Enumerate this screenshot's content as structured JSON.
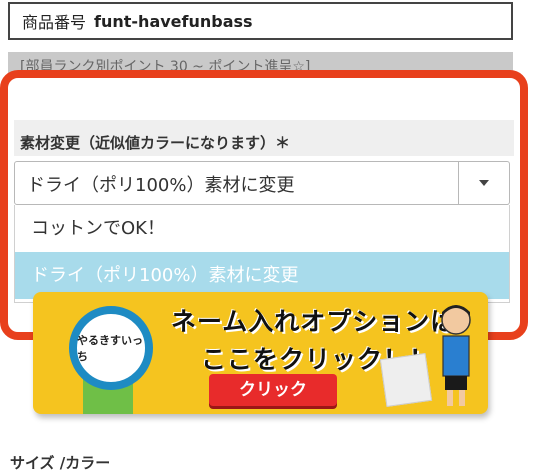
{
  "product": {
    "label": "商品番号",
    "code": "funt-havefunbass"
  },
  "points_banner": {
    "text": "[部員ランク別ポイント 30 ~ ポイント進呈☆]"
  },
  "option": {
    "label": "素材変更（近似値カラーになります）＊",
    "selected_value": "ドライ（ポリ100%）素材に変更",
    "options": [
      "コットンでOK！",
      "ドライ（ポリ100%）素材に変更"
    ]
  },
  "name_banner": {
    "title_line1": "ネーム入れオプションは",
    "title_line2": "ここをクリック！！",
    "button_label": "クリック",
    "badge_text": "やるきすいっち"
  },
  "size_heading": "サイズ /カラー",
  "colors": {
    "highlight_border": "#e8401c",
    "selected_option_bg": "#a8dbeb",
    "banner_bg": "#f5c41f",
    "button_red": "#e82b2b"
  }
}
